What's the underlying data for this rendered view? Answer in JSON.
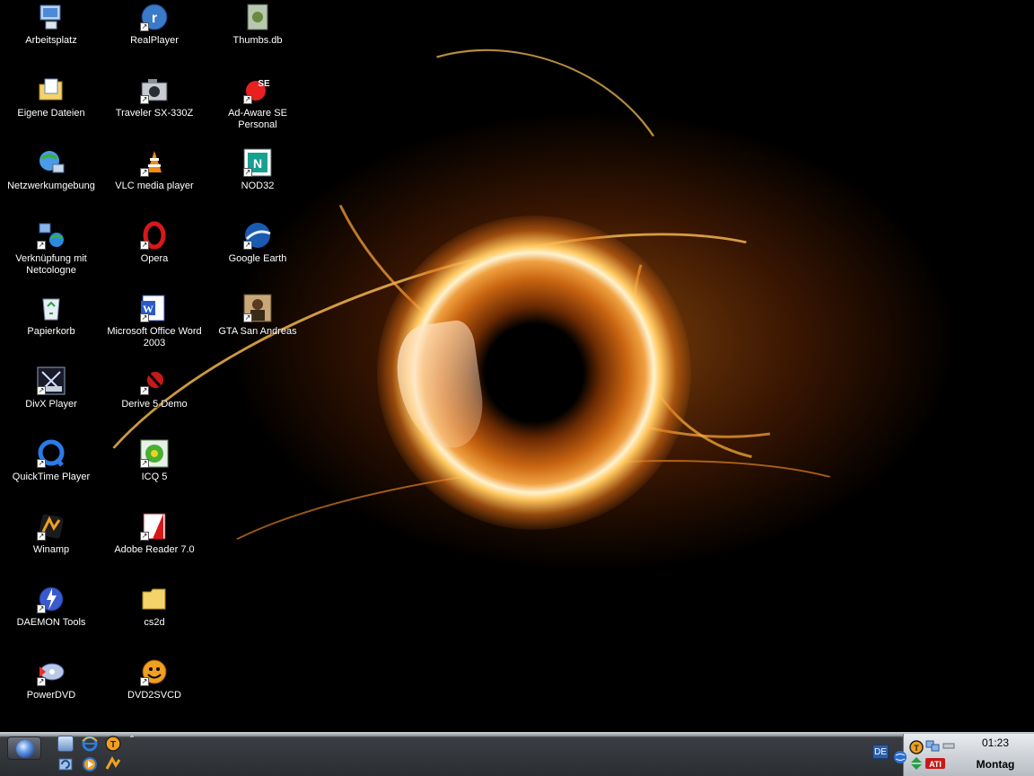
{
  "desktop": {
    "icons": [
      {
        "label": "Arbeitsplatz",
        "icon": "my-computer-icon"
      },
      {
        "label": "Eigene Dateien",
        "icon": "my-documents-icon"
      },
      {
        "label": "Netzwerkumgebung",
        "icon": "network-places-icon"
      },
      {
        "label": "Verknüpfung mit Netcologne",
        "icon": "network-connection-icon"
      },
      {
        "label": "Papierkorb",
        "icon": "recycle-bin-icon"
      },
      {
        "label": "DivX Player",
        "icon": "divx-player-icon"
      },
      {
        "label": "QuickTime Player",
        "icon": "quicktime-icon"
      },
      {
        "label": "Winamp",
        "icon": "winamp-icon"
      },
      {
        "label": "DAEMON Tools",
        "icon": "daemon-tools-icon"
      },
      {
        "label": "PowerDVD",
        "icon": "powerdvd-icon"
      },
      {
        "label": "RealPlayer",
        "icon": "realplayer-icon"
      },
      {
        "label": "Traveler SX-330Z",
        "icon": "camera-icon"
      },
      {
        "label": "VLC media player",
        "icon": "vlc-cone-icon"
      },
      {
        "label": "Opera",
        "icon": "opera-icon"
      },
      {
        "label": "Microsoft Office Word 2003",
        "icon": "word-icon"
      },
      {
        "label": "Derive 5 Demo",
        "icon": "derive-icon"
      },
      {
        "label": "ICQ 5",
        "icon": "icq-flower-icon"
      },
      {
        "label": "Adobe Reader 7.0",
        "icon": "adobe-reader-icon"
      },
      {
        "label": "cs2d",
        "icon": "folder-icon"
      },
      {
        "label": "DVD2SVCD",
        "icon": "dvd2svcd-icon"
      },
      {
        "label": "Thumbs.db",
        "icon": "thumbs-db-file-icon"
      },
      {
        "label": "Ad-Aware SE Personal",
        "icon": "ad-aware-icon"
      },
      {
        "label": "NOD32",
        "icon": "nod32-icon"
      },
      {
        "label": "Google Earth",
        "icon": "google-earth-icon"
      },
      {
        "label": "GTA San Andreas",
        "icon": "gta-san-andreas-icon"
      }
    ]
  },
  "taskbar": {
    "quick_launch": [
      "show-desktop-icon",
      "internet-explorer-icon",
      "trillian-icon",
      "refresh-icon",
      "media-player-icon",
      "winamp-quick-icon"
    ],
    "expand_symbol": "ˆ",
    "language": "DE",
    "clock": {
      "time": "01:23",
      "day": "Montag"
    }
  },
  "colors": {
    "taskbar_dark": "#2b2e33",
    "tray_light": "#e0e3e7",
    "accent_orange": "#f09030"
  }
}
